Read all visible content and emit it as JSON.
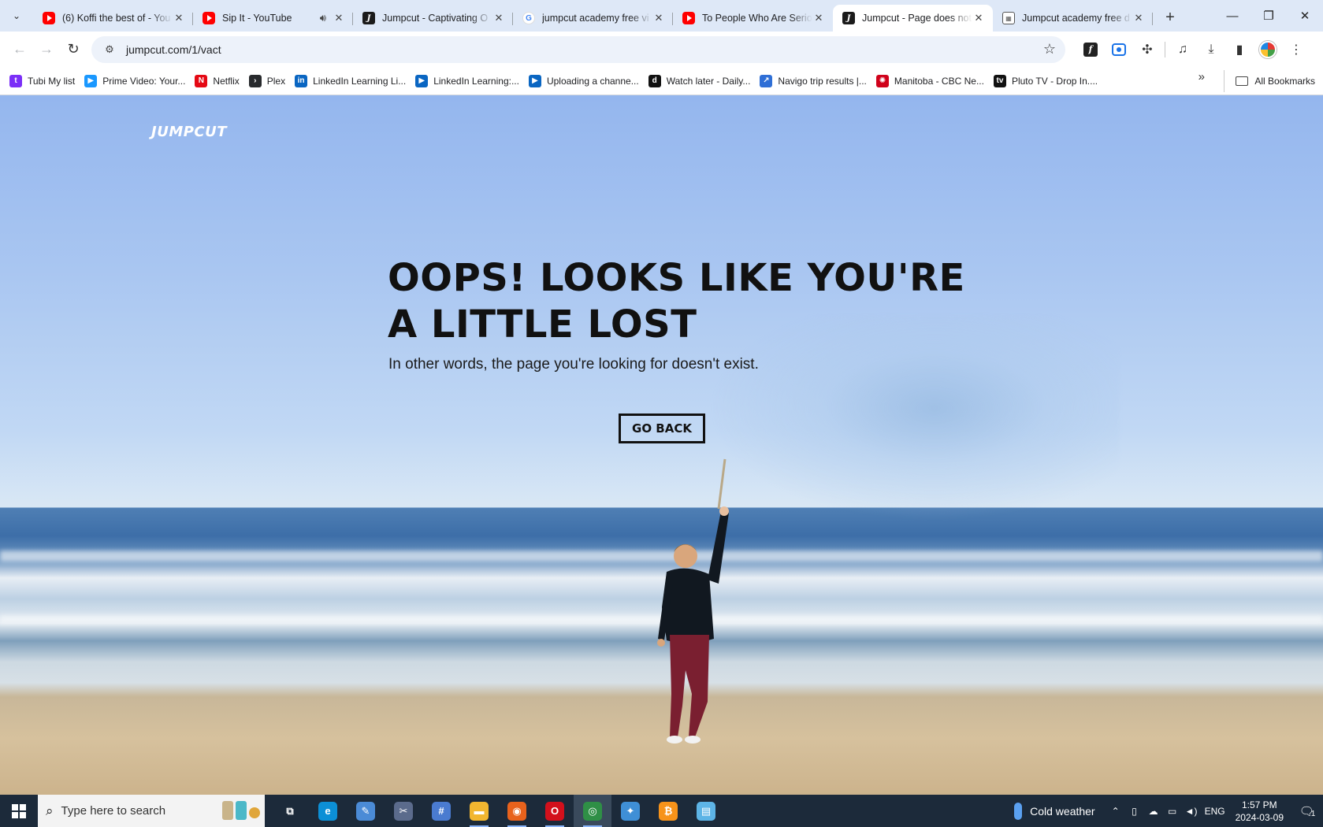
{
  "browser": {
    "tabs": [
      {
        "title": "(6) Koffi the best of - You",
        "favicon": "youtube-icon",
        "audio": false
      },
      {
        "title": "Sip It - YouTube",
        "favicon": "youtube-icon",
        "audio": true
      },
      {
        "title": "Jumpcut - Captivating O",
        "favicon": "jumpcut-icon",
        "audio": false
      },
      {
        "title": "jumpcut academy free vi",
        "favicon": "google-icon",
        "audio": false
      },
      {
        "title": "To People Who Are Serio",
        "favicon": "youtube-icon",
        "audio": false
      },
      {
        "title": "Jumpcut - Page does not",
        "favicon": "jumpcut-icon",
        "audio": false,
        "active": true
      },
      {
        "title": "Jumpcut academy free d",
        "favicon": "document-icon",
        "audio": false
      }
    ],
    "url": "jumpcut.com/1/vact",
    "bookmarks": [
      {
        "label": "Tubi My list",
        "icon": "tubi-icon",
        "color": "#7b2ff7"
      },
      {
        "label": "Prime Video: Your...",
        "icon": "prime-video-icon",
        "color": "#1a98ff"
      },
      {
        "label": "Netflix",
        "icon": "netflix-icon",
        "color": "#e50914"
      },
      {
        "label": "Plex",
        "icon": "plex-icon",
        "color": "#282a2d"
      },
      {
        "label": "LinkedIn Learning Li...",
        "icon": "linkedin-icon",
        "color": "#0a66c2"
      },
      {
        "label": "LinkedIn Learning:...",
        "icon": "linkedin-learning-icon",
        "color": "#0a66c2"
      },
      {
        "label": "Uploading a channe...",
        "icon": "linkedin-learning-icon",
        "color": "#0a66c2"
      },
      {
        "label": "Watch later - Daily...",
        "icon": "dailymotion-icon",
        "color": "#111111"
      },
      {
        "label": "Navigo trip results |...",
        "icon": "navigo-icon",
        "color": "#2f6fd6"
      },
      {
        "label": "Manitoba - CBC Ne...",
        "icon": "cbc-icon",
        "color": "#d0021b"
      },
      {
        "label": "Pluto TV - Drop In....",
        "icon": "pluto-tv-icon",
        "color": "#111111"
      }
    ],
    "all_bookmarks_label": "All Bookmarks"
  },
  "page": {
    "logo": "JUMPCUT",
    "headline": "OOPS! LOOKS LIKE YOU'RE A LITTLE LOST",
    "subtext": "In other words, the page you're looking for doesn't exist.",
    "button_label": "GO BACK"
  },
  "taskbar": {
    "search_placeholder": "Type here to search",
    "weather": "Cold weather",
    "language": "ENG",
    "time": "1:57 PM",
    "date": "2024-03-09",
    "notification_count": "1",
    "apps": [
      {
        "name": "task-view-icon",
        "color": "#1c2a3a",
        "glyph": "⧉"
      },
      {
        "name": "edge-icon",
        "color": "#0c8fd6",
        "glyph": "e"
      },
      {
        "name": "paint-icon",
        "color": "#4b8bd6",
        "glyph": "✎"
      },
      {
        "name": "snipping-tool-icon",
        "color": "#5b6b8c",
        "glyph": "✂"
      },
      {
        "name": "calculator-icon",
        "color": "#4a7bd0",
        "glyph": "#"
      },
      {
        "name": "file-explorer-icon",
        "color": "#f2b630",
        "glyph": "▬"
      },
      {
        "name": "firefox-icon",
        "color": "#e8621c",
        "glyph": "◉"
      },
      {
        "name": "opera-icon",
        "color": "#d3101c",
        "glyph": "O"
      },
      {
        "name": "chrome-icon",
        "color": "#2f8f46",
        "glyph": "◎"
      },
      {
        "name": "safari-icon",
        "color": "#3f8fd6",
        "glyph": "✦"
      },
      {
        "name": "bitcoin-icon",
        "color": "#f7931a",
        "glyph": "₿"
      },
      {
        "name": "notepad-icon",
        "color": "#5db4e6",
        "glyph": "▤"
      }
    ]
  }
}
